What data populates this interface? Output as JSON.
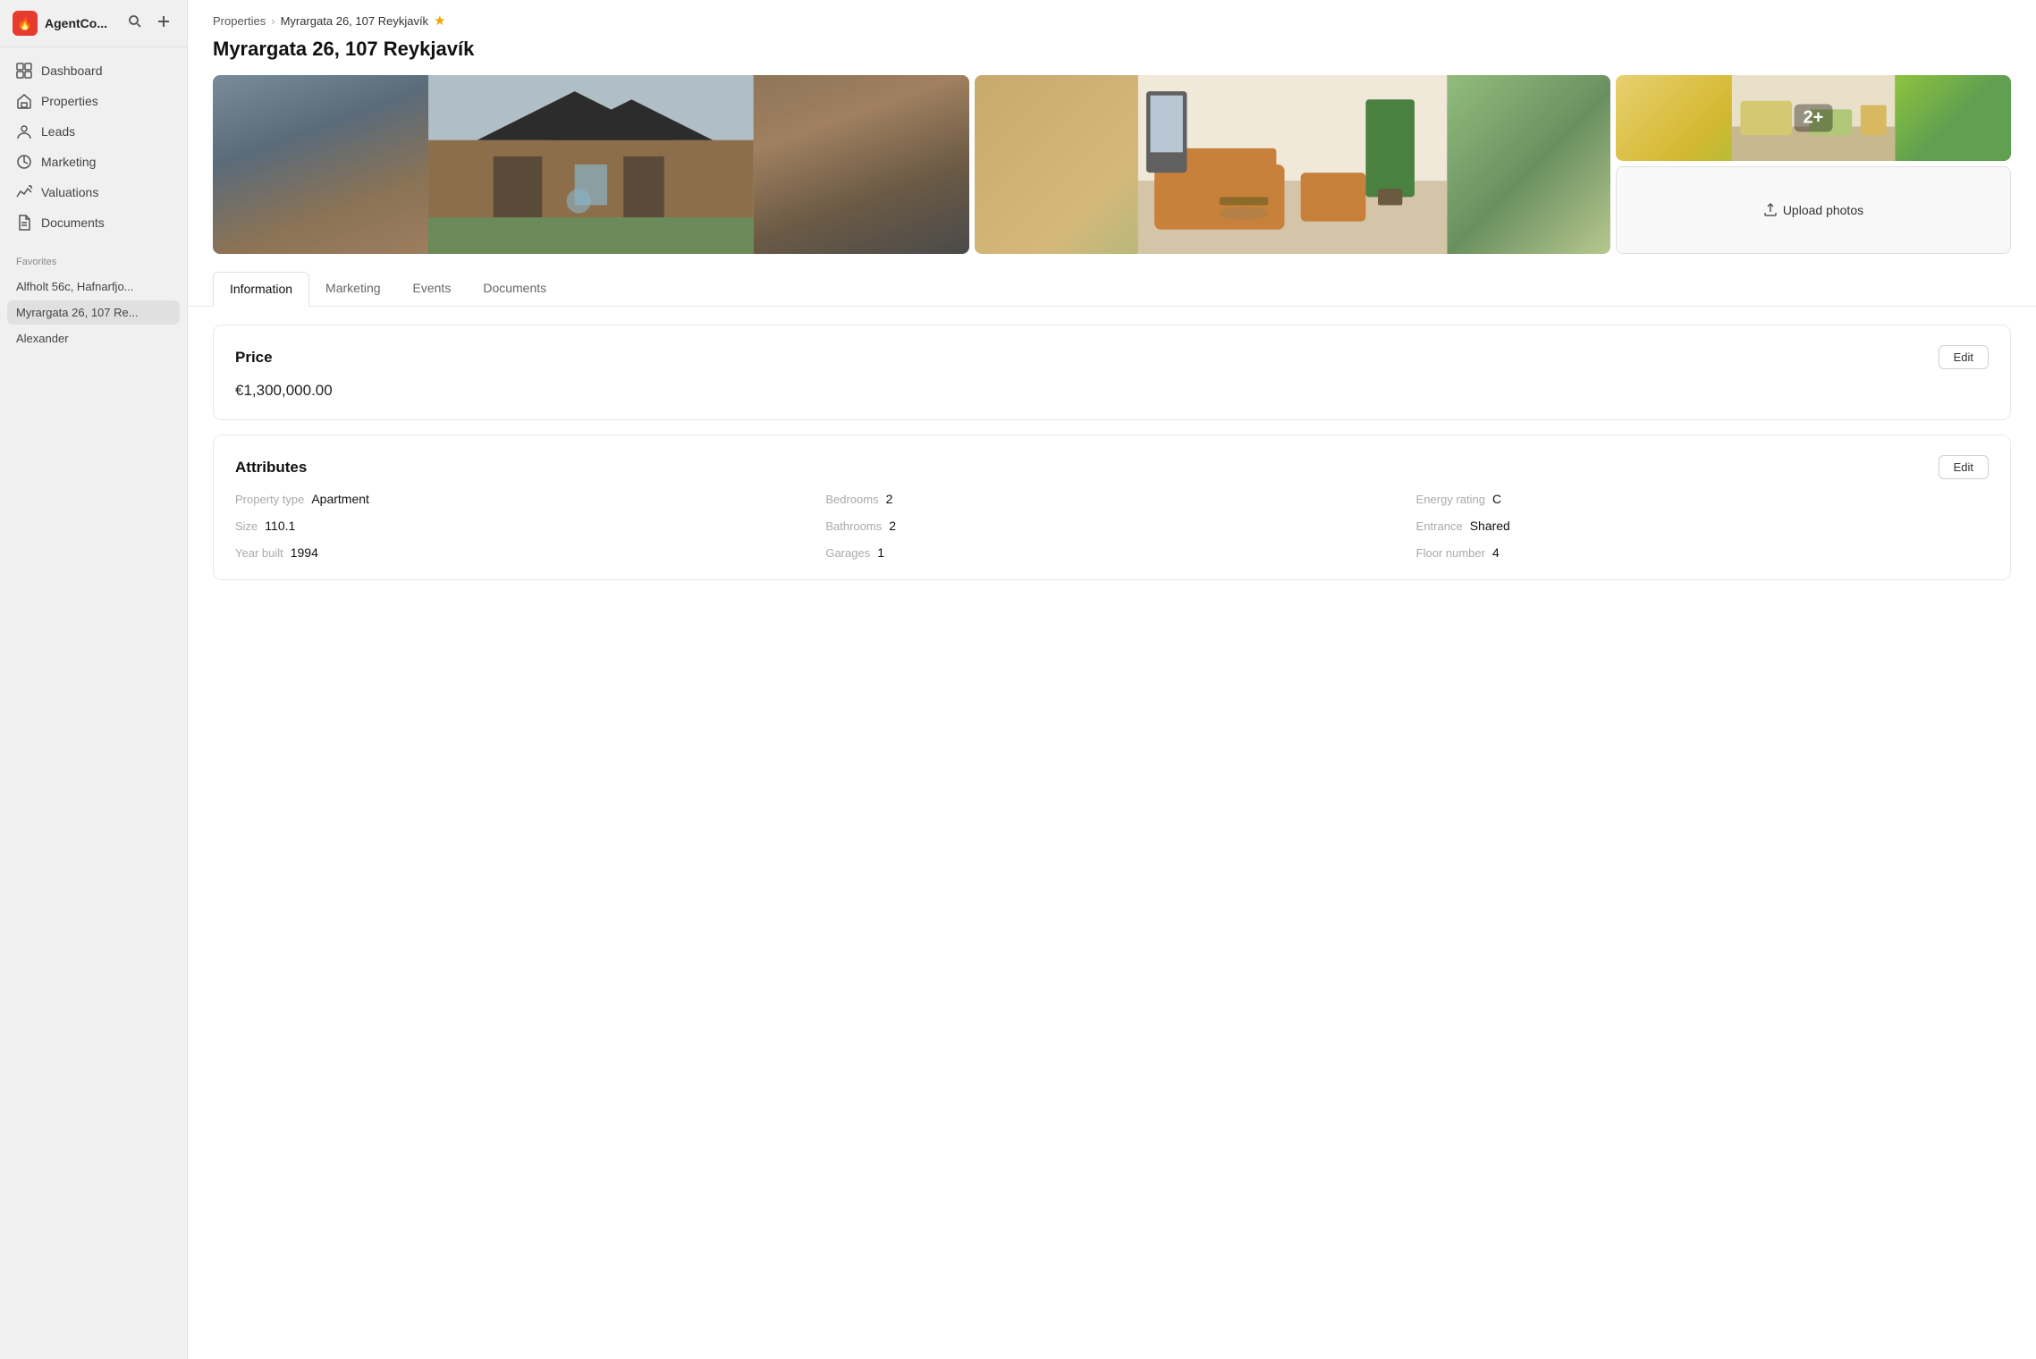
{
  "app": {
    "name": "AgentCo...",
    "logo_char": "🔥"
  },
  "sidebar": {
    "nav_items": [
      {
        "id": "dashboard",
        "label": "Dashboard",
        "icon": "dashboard"
      },
      {
        "id": "properties",
        "label": "Properties",
        "icon": "properties"
      },
      {
        "id": "leads",
        "label": "Leads",
        "icon": "leads"
      },
      {
        "id": "marketing",
        "label": "Marketing",
        "icon": "marketing"
      },
      {
        "id": "valuations",
        "label": "Valuations",
        "icon": "valuations"
      },
      {
        "id": "documents",
        "label": "Documents",
        "icon": "documents"
      }
    ],
    "favorites_label": "Favorites",
    "favorites": [
      {
        "id": "fav1",
        "label": "Alfholt 56c, Hafnarfjo..."
      },
      {
        "id": "fav2",
        "label": "Myrargata 26, 107 Re...",
        "active": true
      },
      {
        "id": "fav3",
        "label": "Alexander"
      }
    ]
  },
  "breadcrumb": {
    "parent": "Properties",
    "current": "Myrargata 26, 107 Reykjavík",
    "star": "★"
  },
  "page": {
    "title": "Myrargata 26, 107 Reykjavík"
  },
  "photos": {
    "overlay_badge": "2+",
    "upload_label": "Upload photos"
  },
  "tabs": [
    {
      "id": "information",
      "label": "Information",
      "active": true
    },
    {
      "id": "marketing",
      "label": "Marketing"
    },
    {
      "id": "events",
      "label": "Events"
    },
    {
      "id": "documents",
      "label": "Documents"
    }
  ],
  "price_section": {
    "title": "Price",
    "edit_label": "Edit",
    "value": "€1,300,000.00"
  },
  "attributes_section": {
    "title": "Attributes",
    "edit_label": "Edit",
    "items": [
      {
        "label": "Property type",
        "value": "Apartment"
      },
      {
        "label": "Bedrooms",
        "value": "2"
      },
      {
        "label": "Energy rating",
        "value": "C"
      },
      {
        "label": "Size",
        "value": "110.1"
      },
      {
        "label": "Bathrooms",
        "value": "2"
      },
      {
        "label": "Entrance",
        "value": "Shared"
      },
      {
        "label": "Year built",
        "value": "1994"
      },
      {
        "label": "Garages",
        "value": "1"
      },
      {
        "label": "Floor number",
        "value": "4"
      }
    ]
  }
}
